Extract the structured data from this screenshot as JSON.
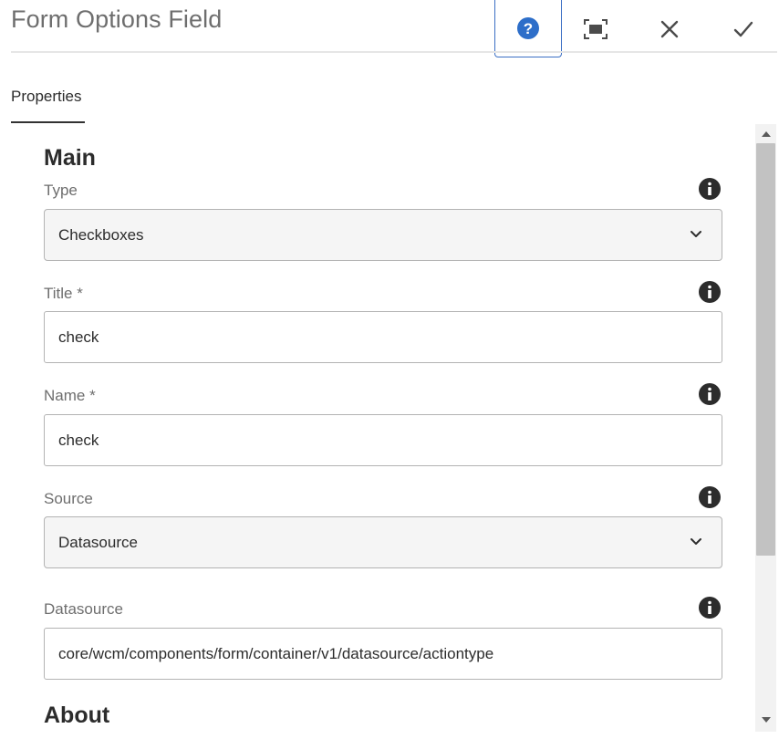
{
  "dialog": {
    "title": "Form Options Field"
  },
  "toolbar": {
    "help_icon": "help-circle-icon",
    "fullscreen_icon": "fullscreen-icon",
    "close_icon": "close-icon",
    "done_icon": "checkmark-icon",
    "accent_color": "#3b6fc4"
  },
  "tabs": [
    {
      "label": "Properties",
      "active": true
    }
  ],
  "sections": {
    "main": {
      "title": "Main"
    },
    "about": {
      "title": "About"
    }
  },
  "fields": {
    "type": {
      "label": "Type",
      "value": "Checkboxes",
      "kind": "select"
    },
    "title": {
      "label": "Title *",
      "value": "check",
      "kind": "text"
    },
    "name": {
      "label": "Name *",
      "value": "check",
      "kind": "text"
    },
    "source": {
      "label": "Source",
      "value": "Datasource",
      "kind": "select"
    },
    "datasource": {
      "label": "Datasource",
      "value": "core/wcm/components/form/container/v1/datasource/actiontype",
      "kind": "text"
    }
  }
}
